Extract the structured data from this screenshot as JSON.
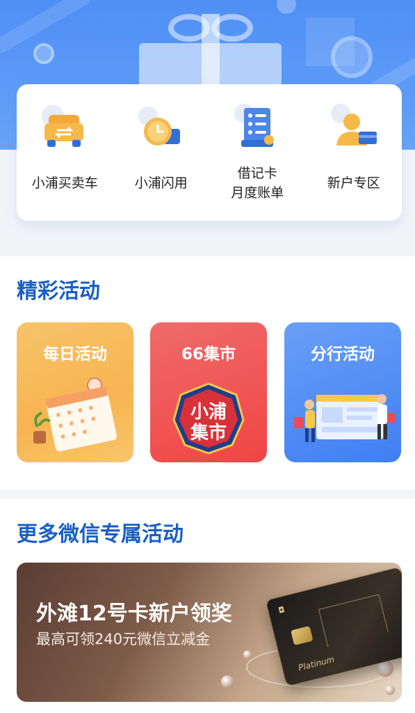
{
  "services": [
    {
      "label": "小浦买卖车",
      "icon": "car-exchange-icon"
    },
    {
      "label": "小浦闪用",
      "icon": "clock-card-icon"
    },
    {
      "label": "借记卡\n月度账单",
      "icon": "bill-icon"
    },
    {
      "label": "新户专区",
      "icon": "new-user-icon"
    }
  ],
  "activities": {
    "title": "精彩活动",
    "items": [
      {
        "label": "每日活动",
        "icon": "calendar-icon"
      },
      {
        "label": "66集市",
        "icon": "market-badge-icon",
        "badge_text": "小浦\n集市"
      },
      {
        "label": "分行活动",
        "icon": "shopping-people-icon"
      }
    ]
  },
  "wechat": {
    "title": "更多微信专属活动",
    "banner": {
      "title": "外滩12号卡新户领奖",
      "subtitle": "最高可领240元微信立减金",
      "card_text": "Platinum"
    }
  },
  "colors": {
    "brand_blue": "#1a5fc8",
    "hero_blue": "#4f8ff5"
  }
}
